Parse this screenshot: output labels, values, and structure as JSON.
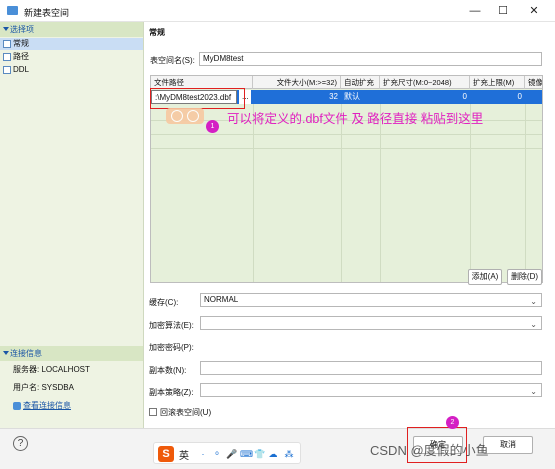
{
  "window": {
    "title": "新建表空间",
    "minimize": "—",
    "maximize": "☐",
    "close": "✕"
  },
  "sidebar": {
    "options_header": "选择项",
    "items": [
      {
        "label": "常规"
      },
      {
        "label": "路径"
      },
      {
        "label": "DDL"
      }
    ],
    "conn_header": "连接信息",
    "server_label": "服务器: LOCALHOST",
    "user_label": "用户名: SYSDBA",
    "view_conn_link": "查看连接信息"
  },
  "main": {
    "section_title": "常规",
    "tablespace_name_label": "表空间名(S):",
    "tablespace_name_value": "MyDM8test",
    "grid": {
      "columns": [
        "文件路径",
        "文件大小(M:>=32)",
        "自动扩充",
        "扩充尺寸(M:0~2048)",
        "扩充上限(M)",
        "镜像"
      ],
      "row": {
        "path": ":\\MyDM8test2023.dbf",
        "size": "32",
        "auto_extend": "默认",
        "extend_size": "0",
        "extend_max": "0",
        "mirror": ""
      },
      "browse": "..."
    },
    "add_button": "添加(A)",
    "delete_button": "删除(D)",
    "cache_label": "缓存(C):",
    "cache_value": "NORMAL",
    "encrypt_algo_label": "加密算法(E):",
    "encrypt_algo_value": "",
    "encrypt_pwd_label": "加密密码(P):",
    "replica_count_label": "副本数(N):",
    "replica_count_value": "",
    "replica_policy_label": "副本策略(Z):",
    "replica_policy_value": "",
    "rollback_label": "回滚表空间(U)"
  },
  "annotations": {
    "note": "可以将定义的.dbf文件 及 路径直接  粘贴到这里",
    "badge1": "1",
    "badge2": "2"
  },
  "bottom": {
    "help": "?",
    "ok_button": "确定",
    "cancel_button": "取消",
    "ime_s": "S",
    "ime_lang": "英",
    "ime_icons": [
      "·",
      "ͦ",
      "🎤",
      "⌨",
      "👕",
      "☁",
      "⁂"
    ],
    "watermark": "CSDN @度假的小鱼"
  }
}
